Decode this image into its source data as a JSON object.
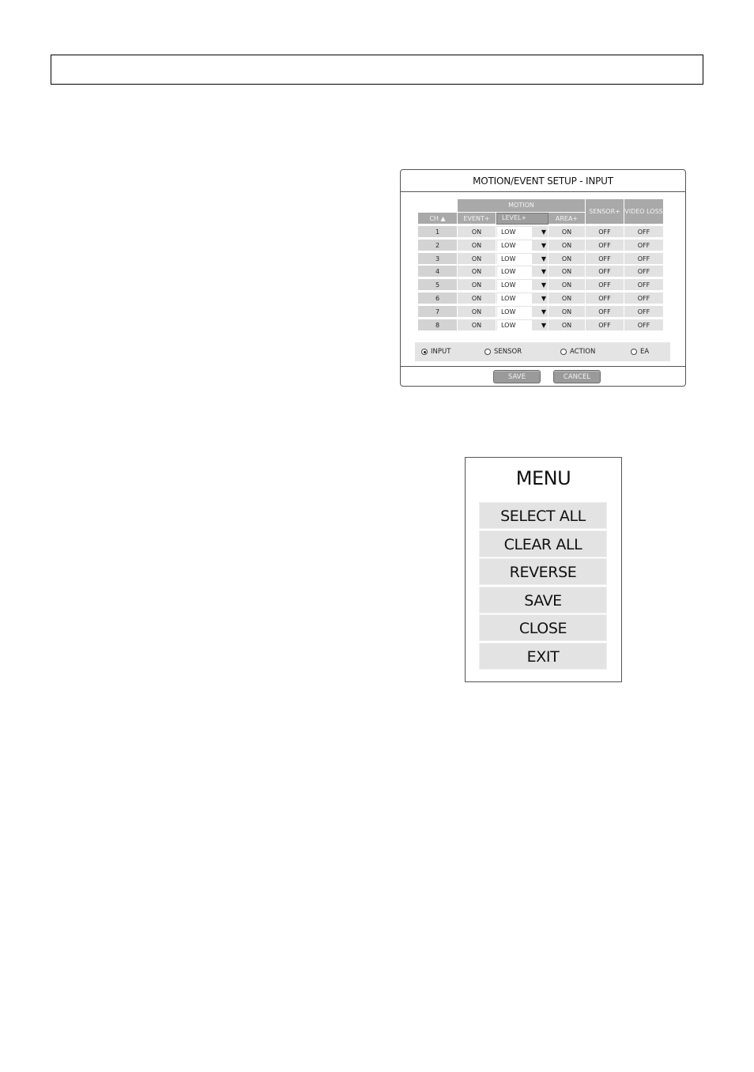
{
  "top_box": {},
  "dialog": {
    "title": "MOTION/EVENT SETUP - INPUT",
    "group_header": "MOTION",
    "columns": {
      "ch": "CH ▲",
      "event": "EVENT+",
      "level": "LEVEL+",
      "area": "AREA+",
      "sensor": "SENSOR+",
      "video_loss": "VIDEO LOSS"
    },
    "rows": [
      {
        "ch": "1",
        "event": "ON",
        "level": "LOW",
        "area": "ON",
        "sensor": "OFF",
        "video_loss": "OFF"
      },
      {
        "ch": "2",
        "event": "ON",
        "level": "LOW",
        "area": "ON",
        "sensor": "OFF",
        "video_loss": "OFF"
      },
      {
        "ch": "3",
        "event": "ON",
        "level": "LOW",
        "area": "ON",
        "sensor": "OFF",
        "video_loss": "OFF"
      },
      {
        "ch": "4",
        "event": "ON",
        "level": "LOW",
        "area": "ON",
        "sensor": "OFF",
        "video_loss": "OFF"
      },
      {
        "ch": "5",
        "event": "ON",
        "level": "LOW",
        "area": "ON",
        "sensor": "OFF",
        "video_loss": "OFF"
      },
      {
        "ch": "6",
        "event": "ON",
        "level": "LOW",
        "area": "ON",
        "sensor": "OFF",
        "video_loss": "OFF"
      },
      {
        "ch": "7",
        "event": "ON",
        "level": "LOW",
        "area": "ON",
        "sensor": "OFF",
        "video_loss": "OFF"
      },
      {
        "ch": "8",
        "event": "ON",
        "level": "LOW",
        "area": "ON",
        "sensor": "OFF",
        "video_loss": "OFF"
      }
    ],
    "dropdown_icon": "▼",
    "radios": [
      {
        "label": "INPUT",
        "selected": true
      },
      {
        "label": "SENSOR",
        "selected": false
      },
      {
        "label": "ACTION",
        "selected": false
      },
      {
        "label": "EA",
        "selected": false
      }
    ],
    "buttons": {
      "save": "SAVE",
      "cancel": "CANCEL"
    }
  },
  "menu": {
    "title": "MENU",
    "items": [
      {
        "label": "SELECT ALL"
      },
      {
        "label": "CLEAR ALL"
      },
      {
        "label": "REVERSE"
      },
      {
        "label": "SAVE"
      },
      {
        "label": "CLOSE"
      },
      {
        "label": "EXIT"
      }
    ]
  }
}
